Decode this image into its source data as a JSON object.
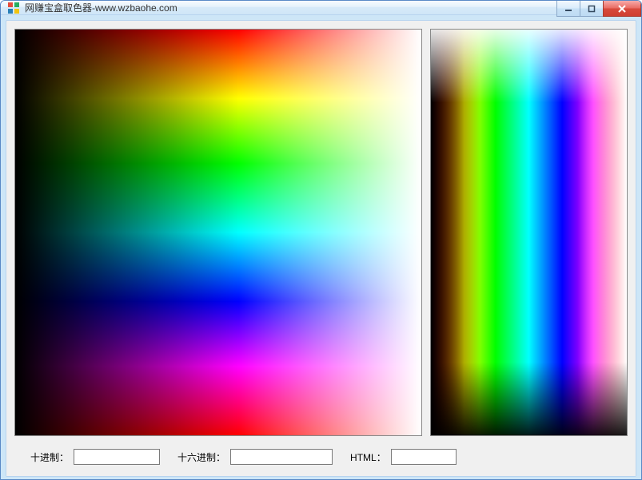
{
  "window": {
    "title": "网赚宝盒取色器-www.wzbaohe.com"
  },
  "fields": {
    "decimal": {
      "label": "十进制：",
      "value": ""
    },
    "hex": {
      "label": "十六进制：",
      "value": ""
    },
    "html": {
      "label": "HTML：",
      "value": ""
    }
  },
  "icons": {
    "app": "color-picker-icon",
    "minimize": "minimize-icon",
    "maximize": "maximize-icon",
    "close": "close-icon"
  }
}
